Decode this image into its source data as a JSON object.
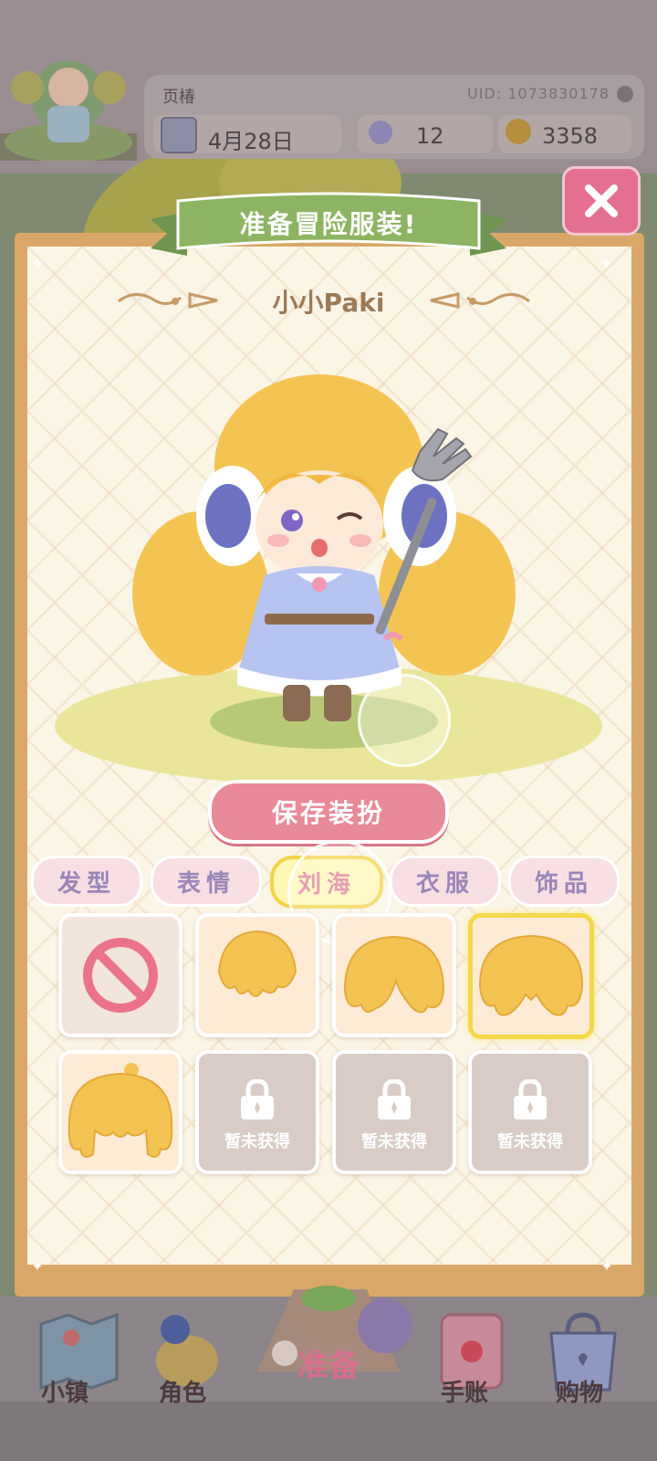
{
  "header": {
    "player_name": "页椿",
    "uid": "UID: 1073830178",
    "date": "4月28日",
    "flowers": "12",
    "coins": "3358"
  },
  "dialog": {
    "banner_title": "准备冒险服装!",
    "character_name": "小小Paki",
    "save_label": "保存装扮",
    "tabs": [
      {
        "label": "发型"
      },
      {
        "label": "表情"
      },
      {
        "label": "刘海",
        "active": true
      },
      {
        "label": "衣服"
      },
      {
        "label": "饰品"
      }
    ],
    "items": [
      {
        "type": "none"
      },
      {
        "type": "bangs-1"
      },
      {
        "type": "bangs-2"
      },
      {
        "type": "bangs-3",
        "selected": true
      },
      {
        "type": "bangs-4"
      },
      {
        "type": "locked",
        "label": "暂未获得"
      },
      {
        "type": "locked",
        "label": "暂未获得"
      },
      {
        "type": "locked",
        "label": "暂未获得"
      }
    ]
  },
  "bottom_nav": [
    {
      "label": "小镇",
      "icon": "map-icon"
    },
    {
      "label": "角色",
      "icon": "character-icon"
    },
    {
      "label": "准备",
      "icon": "prepare-icon"
    },
    {
      "label": "手账",
      "icon": "journal-icon"
    },
    {
      "label": "购物",
      "icon": "shopping-bag-icon"
    }
  ],
  "colors": {
    "panel": "#d9a869",
    "accent_pink": "#e98a99",
    "selected_yellow": "#f5d84a",
    "hair": "#f4c453"
  }
}
